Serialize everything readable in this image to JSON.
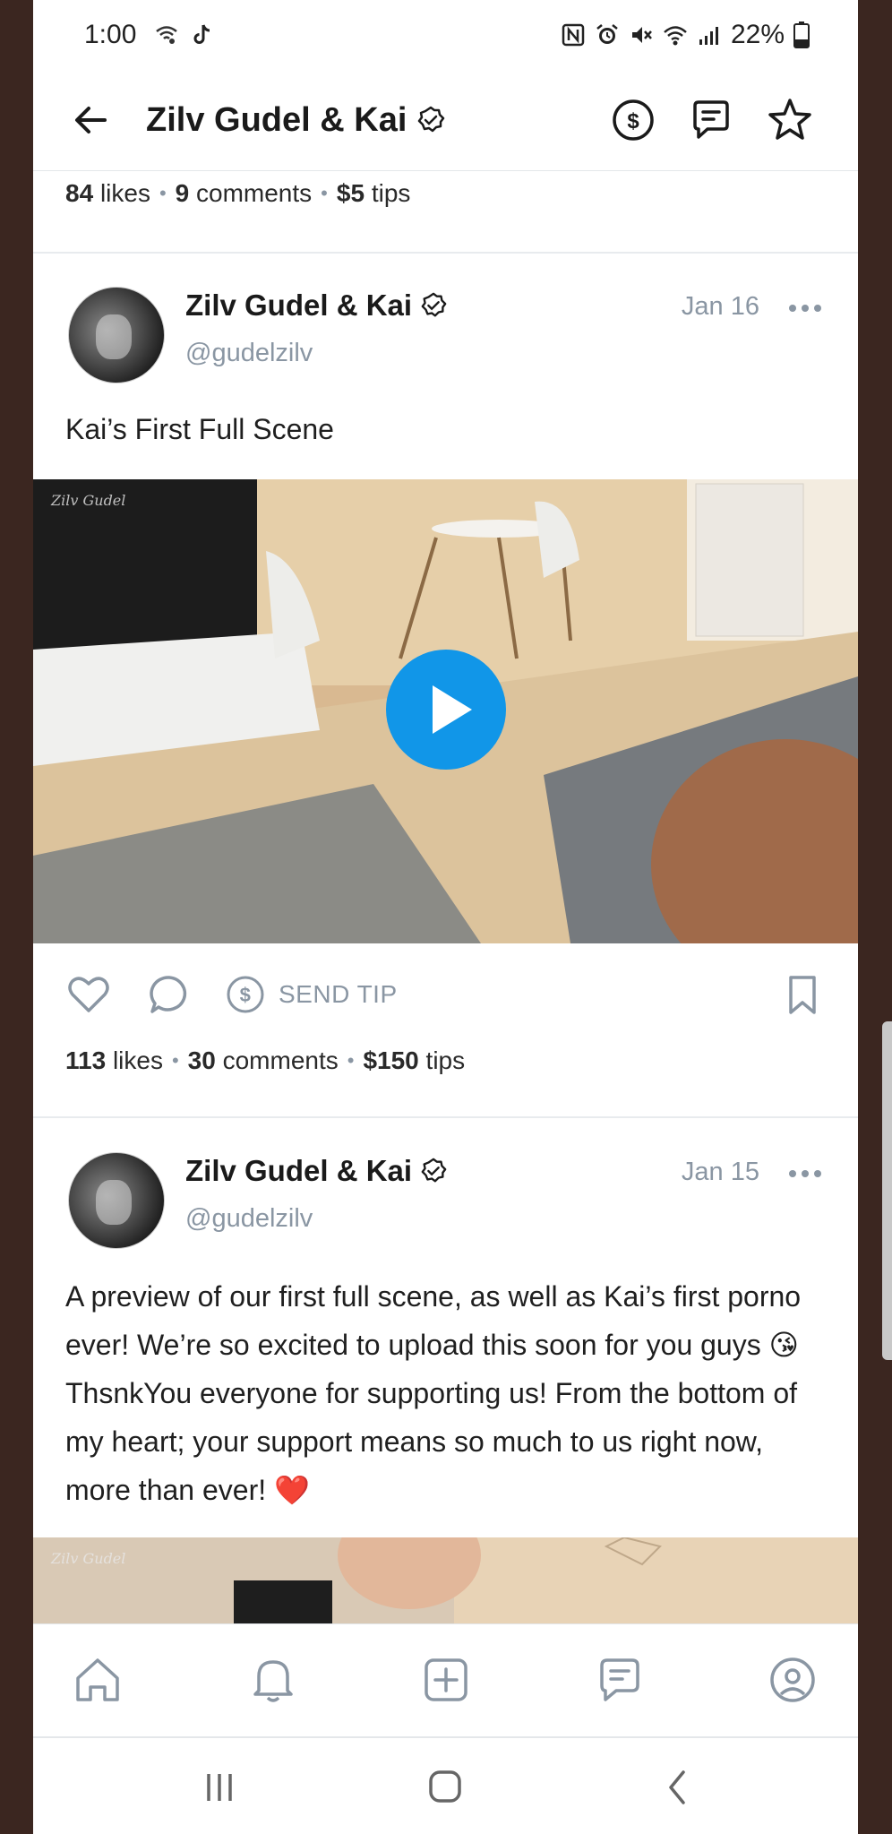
{
  "status_bar": {
    "time": "1:00",
    "battery_percent": "22%"
  },
  "header": {
    "title": "Zilv Gudel & Kai"
  },
  "previous_post_stats": {
    "likes_count": "84",
    "likes_label": "likes",
    "comments_count": "9",
    "comments_label": "comments",
    "tips_amount": "$5",
    "tips_label": "tips"
  },
  "posts": [
    {
      "name": "Zilv Gudel & Kai",
      "handle": "@gudelzilv",
      "date": "Jan 16",
      "text": "Kai’s First Full Scene",
      "send_tip_label": "SEND TIP",
      "likes_count": "113",
      "likes_label": "likes",
      "comments_count": "30",
      "comments_label": "comments",
      "tips_amount": "$150",
      "tips_label": "tips",
      "watermark": "Zilv Gudel"
    },
    {
      "name": "Zilv Gudel & Kai",
      "handle": "@gudelzilv",
      "date": "Jan 15",
      "text_part1": "A preview of our first full scene, as well as Kai’s first porno ever! We’re so excited to upload this soon for you guys ",
      "emoji1": "😘",
      "text_part2": " ThsnkYou everyone for supporting us! From the bottom of my heart; your support means so much to us right now, more than ever! ",
      "emoji2": "❤️",
      "watermark": "Zilv Gudel"
    }
  ],
  "icons": {
    "accent": "#1196e8",
    "muted": "#8a96a3"
  }
}
